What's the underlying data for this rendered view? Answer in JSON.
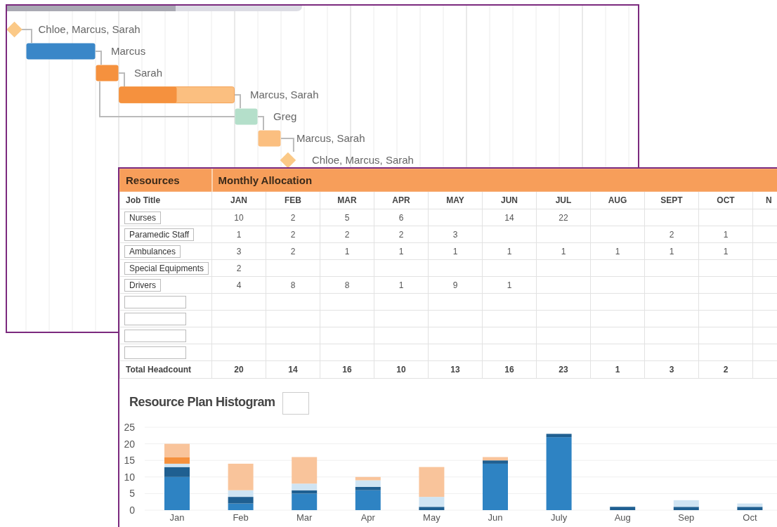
{
  "gantt": {
    "tasks": [
      {
        "kind": "milestone",
        "label": "Chloe, Marcus, Sarah",
        "color": "#fbc987"
      },
      {
        "kind": "bar",
        "label": "Marcus",
        "color": "#3a87c8"
      },
      {
        "kind": "bar",
        "label": "Sarah",
        "color": "#f5913e"
      },
      {
        "kind": "bar",
        "label": "Marcus, Sarah",
        "color": "#f5913e",
        "level": 0.5
      },
      {
        "kind": "bar",
        "label": "Greg",
        "color": "#b4dfca"
      },
      {
        "kind": "bar",
        "label": "Marcus, Sarah",
        "color": "#fbbf80"
      },
      {
        "kind": "milestone",
        "label": "Chloe, Marcus, Sarah",
        "color": "#fbc987"
      }
    ]
  },
  "allocation": {
    "resources_heading": "Resources",
    "monthly_heading": "Monthly Allocation",
    "job_title_heading": "Job Title",
    "months": [
      "JAN",
      "FEB",
      "MAR",
      "APR",
      "MAY",
      "JUN",
      "JUL",
      "AUG",
      "SEPT",
      "OCT",
      "N"
    ],
    "rows": [
      {
        "job_title": "Nurses",
        "cells": [
          {
            "value": "10"
          },
          {
            "value": "2"
          },
          {
            "value": "5"
          },
          {
            "value": "6"
          },
          {},
          {
            "value": "14"
          },
          {
            "value": "22"
          },
          {},
          {},
          {},
          {}
        ]
      },
      {
        "job_title": "Paramedic Staff",
        "cells": [
          {
            "value": "1"
          },
          {
            "value": "2"
          },
          {
            "value": "2"
          },
          {
            "value": "2"
          },
          {
            "value": "3"
          },
          {},
          {},
          {},
          {
            "value": "2"
          },
          {
            "value": "1"
          },
          {}
        ]
      },
      {
        "job_title": "Ambulances",
        "cells": [
          {
            "value": "3"
          },
          {
            "value": "2"
          },
          {
            "value": "1"
          },
          {
            "value": "1"
          },
          {
            "value": "1"
          },
          {
            "value": "1"
          },
          {
            "value": "1"
          },
          {
            "value": "1"
          },
          {
            "value": "1"
          },
          {
            "value": "1"
          },
          {}
        ]
      },
      {
        "job_title": "Special Equipments",
        "cells": [
          {
            "value": "2"
          },
          {},
          {},
          {},
          {},
          {},
          {},
          {},
          {},
          {},
          {}
        ]
      },
      {
        "job_title": "Drivers",
        "cells": [
          {
            "value": "4"
          },
          {
            "value": "8"
          },
          {
            "value": "8"
          },
          {
            "value": "1"
          },
          {
            "value": "9"
          },
          {
            "value": "1"
          },
          {},
          {},
          {},
          {},
          {}
        ]
      }
    ],
    "total": {
      "label": "Total Headcount",
      "cells": [
        {
          "value": "20"
        },
        {
          "value": "14"
        },
        {
          "value": "16"
        },
        {
          "value": "10"
        },
        {
          "value": "13"
        },
        {
          "value": "16"
        },
        {
          "value": "23"
        },
        {
          "value": "1"
        },
        {
          "value": "3"
        },
        {
          "value": "2"
        },
        {}
      ]
    }
  },
  "histogram": {
    "title": "Resource Plan Histogram",
    "chart_data": {
      "type": "bar",
      "stacked": true,
      "grid": true,
      "categories": [
        "Jan",
        "Feb",
        "Mar",
        "Apr",
        "May",
        "Jun",
        "July",
        "Aug",
        "Sep",
        "Oct"
      ],
      "yticks": [
        0,
        5,
        10,
        15,
        20,
        25
      ],
      "ylim": [
        0,
        25
      ],
      "series": [
        {
          "color": "#2e83c3",
          "values": [
            10,
            2,
            5,
            6,
            0,
            14,
            22,
            0,
            0,
            0
          ]
        },
        {
          "color": "#1f5f91",
          "values": [
            3,
            2,
            1,
            1,
            1,
            1,
            1,
            1,
            1,
            1
          ]
        },
        {
          "color": "#cfe4f3",
          "values": [
            1,
            2,
            2,
            2,
            3,
            0,
            0,
            0,
            2,
            1
          ]
        },
        {
          "color": "#f5913e",
          "values": [
            2,
            0,
            0,
            0,
            0,
            0,
            0,
            0,
            0,
            0
          ]
        },
        {
          "color": "#f9c49b",
          "values": [
            4,
            8,
            8,
            1,
            9,
            1,
            0,
            0,
            0,
            0
          ]
        }
      ]
    }
  }
}
